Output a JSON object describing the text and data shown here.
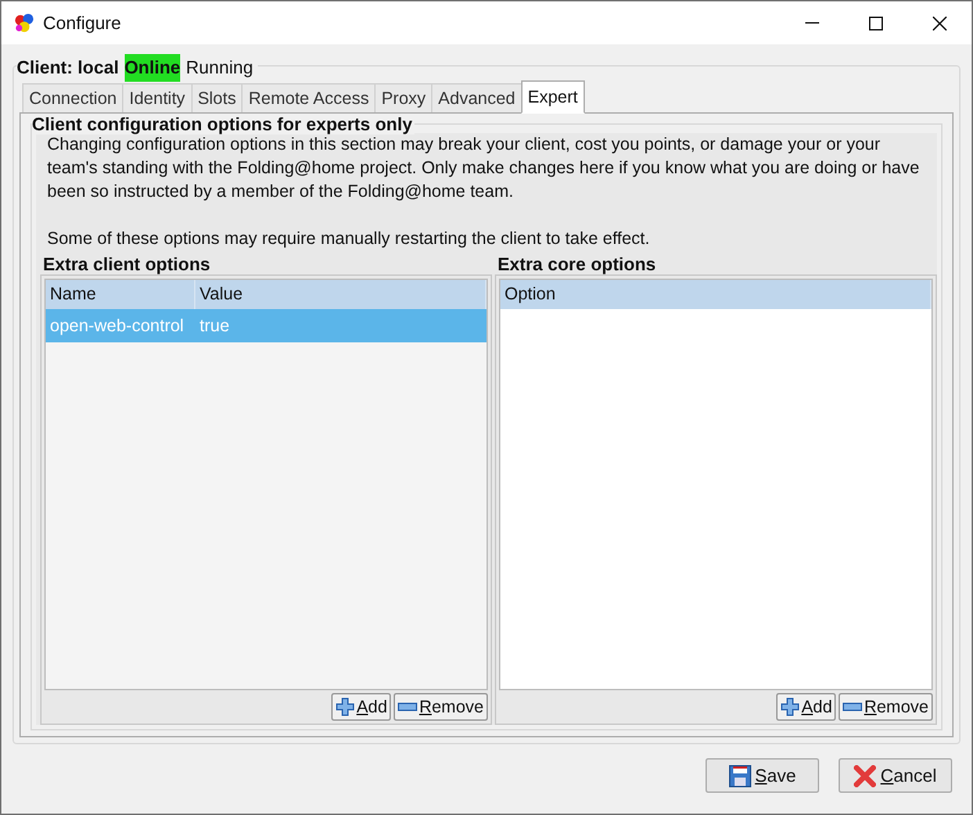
{
  "window": {
    "title": "Configure"
  },
  "client": {
    "label": "Client: local",
    "connection": "Online",
    "state": "Running"
  },
  "tabs": [
    {
      "label": "Connection",
      "selected": false
    },
    {
      "label": "Identity",
      "selected": false
    },
    {
      "label": "Slots",
      "selected": false
    },
    {
      "label": "Remote Access",
      "selected": false
    },
    {
      "label": "Proxy",
      "selected": false
    },
    {
      "label": "Advanced",
      "selected": false
    },
    {
      "label": "Expert",
      "selected": true
    }
  ],
  "section": {
    "title": "Client configuration options for experts only",
    "warning": "Changing configuration options in this section may break your client, cost you points, or damage your or your team's standing with the Folding@home project.  Only make changes here if you know what you are doing or have been so instructed by a member of the Folding@home team.",
    "note": "Some of these options may require manually restarting the client to take effect."
  },
  "client_options": {
    "title": "Extra client options",
    "columns": [
      "Name",
      "Value"
    ],
    "rows": [
      {
        "cells": [
          "open-web-control",
          "true"
        ],
        "selected": true
      }
    ],
    "buttons": [
      "Add",
      "Remove"
    ]
  },
  "core_options": {
    "title": "Extra core options",
    "columns": [
      "Option"
    ],
    "buttons": [
      "Add",
      "Remove"
    ]
  },
  "buttons": [
    "Save",
    "Cancel"
  ]
}
